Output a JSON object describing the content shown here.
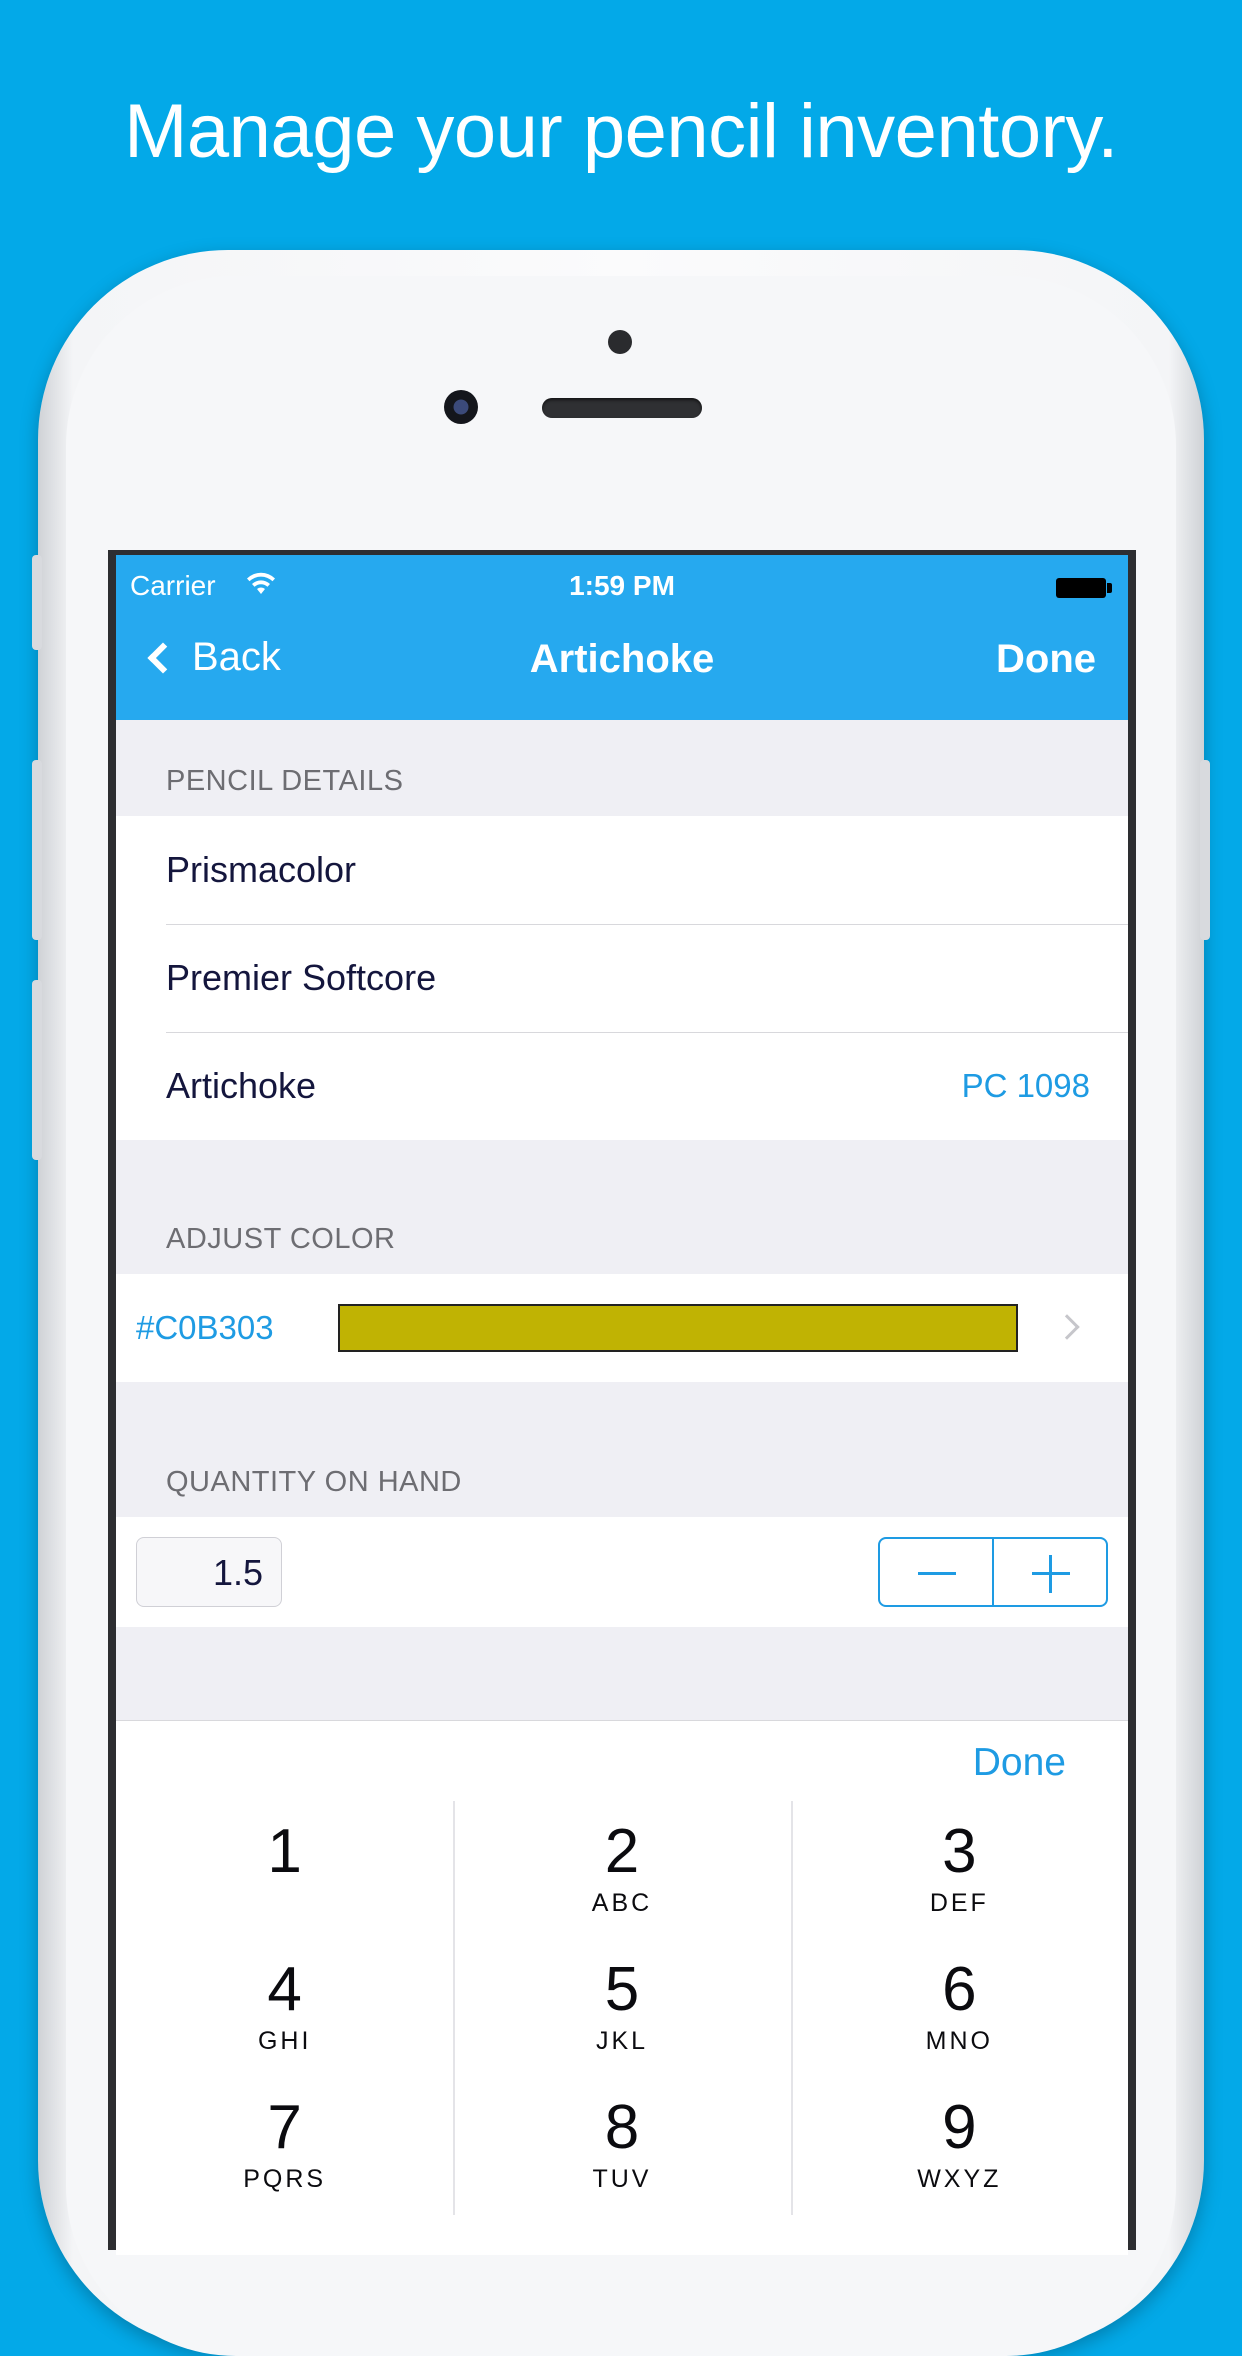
{
  "headline": "Manage your pencil inventory.",
  "status_bar": {
    "carrier": "Carrier",
    "time": "1:59 PM"
  },
  "nav": {
    "back_label": "Back",
    "title": "Artichoke",
    "done_label": "Done"
  },
  "sections": {
    "pencil_details": {
      "header": "PENCIL DETAILS",
      "rows": [
        {
          "label": "Prismacolor"
        },
        {
          "label": "Premier Softcore"
        },
        {
          "label": "Artichoke",
          "detail": "PC 1098"
        }
      ]
    },
    "adjust_color": {
      "header": "ADJUST COLOR",
      "hex": "#C0B303",
      "swatch_color": "#C0B303"
    },
    "quantity": {
      "header": "QUANTITY ON HAND",
      "value": "1.5"
    }
  },
  "keyboard": {
    "done_label": "Done",
    "keys": [
      {
        "num": "1",
        "letters": ""
      },
      {
        "num": "2",
        "letters": "ABC"
      },
      {
        "num": "3",
        "letters": "DEF"
      },
      {
        "num": "4",
        "letters": "GHI"
      },
      {
        "num": "5",
        "letters": "JKL"
      },
      {
        "num": "6",
        "letters": "MNO"
      },
      {
        "num": "7",
        "letters": "PQRS"
      },
      {
        "num": "8",
        "letters": "TUV"
      },
      {
        "num": "9",
        "letters": "WXYZ"
      }
    ]
  },
  "colors": {
    "background": "#03A9E8",
    "nav_bar": "#26A9EF",
    "accent": "#1E9BE3"
  }
}
